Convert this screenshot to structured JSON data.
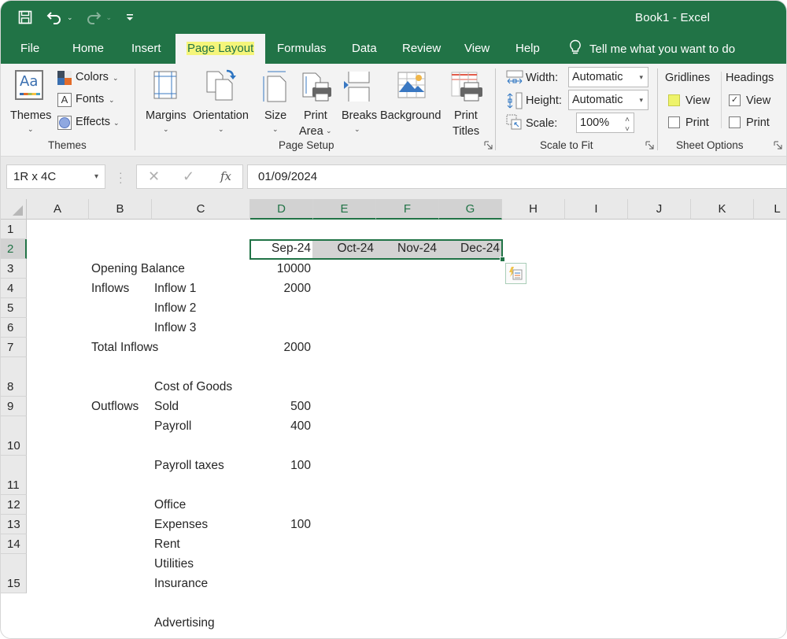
{
  "window": {
    "title": "Book1  -  Excel"
  },
  "quick_access": {
    "save_icon": "save-icon",
    "undo_icon": "undo-icon",
    "redo_icon": "redo-icon",
    "customize_icon": "customize-qat-icon",
    "caret": "⌄"
  },
  "menu_tabs": [
    {
      "label": "File"
    },
    {
      "label": "Home"
    },
    {
      "label": "Insert"
    },
    {
      "label": "Page Layout",
      "active": true
    },
    {
      "label": "Formulas"
    },
    {
      "label": "Data"
    },
    {
      "label": "Review"
    },
    {
      "label": "View"
    },
    {
      "label": "Help"
    }
  ],
  "tell_me": {
    "label": "Tell me what you want to do",
    "icon": "lightbulb-icon"
  },
  "ribbon": {
    "themes_group": {
      "label": "Themes",
      "themes_button": "Themes",
      "colors": "Colors",
      "fonts": "Fonts",
      "effects": "Effects",
      "themes_glyph": "Aa",
      "fonts_glyph": "A"
    },
    "page_setup_group": {
      "label": "Page Setup",
      "margins": "Margins",
      "orientation": "Orientation",
      "size": "Size",
      "print_area_1": "Print",
      "print_area_2": "Area",
      "breaks": "Breaks",
      "background": "Background",
      "print_titles_1": "Print",
      "print_titles_2": "Titles"
    },
    "scale_group": {
      "label": "Scale to Fit",
      "width_label": "Width:",
      "width_value": "Automatic",
      "height_label": "Height:",
      "height_value": "Automatic",
      "scale_label": "Scale:",
      "scale_value": "100%"
    },
    "sheet_options_group": {
      "label": "Sheet Options",
      "gridlines": "Gridlines",
      "headings": "Headings",
      "gridlines_view": "View",
      "gridlines_print": "Print",
      "headings_view": "View",
      "headings_print": "Print",
      "gridlines_view_checked": false,
      "gridlines_print_checked": false,
      "headings_view_checked": true,
      "headings_print_checked": false,
      "check_glyph": "✓"
    },
    "chevron": "⌄"
  },
  "formula_bar": {
    "name_box": "1R x 4C",
    "cancel": "✕",
    "enter": "✓",
    "fx": "fx",
    "value": "01/09/2024",
    "dropdown_arrow": "▾"
  },
  "columns": [
    "A",
    "B",
    "C",
    "D",
    "E",
    "F",
    "G",
    "H",
    "I",
    "J",
    "K",
    "L"
  ],
  "selected_columns": [
    "D",
    "E",
    "F",
    "G"
  ],
  "rows": [
    "1",
    "2",
    "3",
    "4",
    "5",
    "6",
    "7",
    "8",
    "9",
    "10",
    "11",
    "12",
    "13",
    "14",
    "15"
  ],
  "selected_row": "2",
  "cells": {
    "D2": "Sep-24",
    "E2": "Oct-24",
    "F2": "Nov-24",
    "G2": "Dec-24",
    "B3": "Opening Balance",
    "D3": "10000",
    "B4": "Inflows",
    "C4": "Inflow 1",
    "D4": "2000",
    "C5": "Inflow 2",
    "C6": "Inflow 3",
    "B7": "Total Inflows",
    "D7": "2000",
    "B8": "Outflows",
    "C8_line1": "Cost of Goods",
    "C8_line2": "Sold",
    "D8": "500",
    "C9": "Payroll",
    "D9": "400",
    "C10": "Payroll taxes",
    "D10": "100",
    "C11_line1": "Office",
    "C11_line2": "Expenses",
    "D11": "100",
    "C12": "Rent",
    "C13": "Utilities",
    "C14": "Insurance",
    "C15": "Advertising"
  },
  "colors": {
    "excel_green": "#217346",
    "highlight_yellow": "#f5f57a",
    "selection_fill": "#d3d3d3"
  }
}
